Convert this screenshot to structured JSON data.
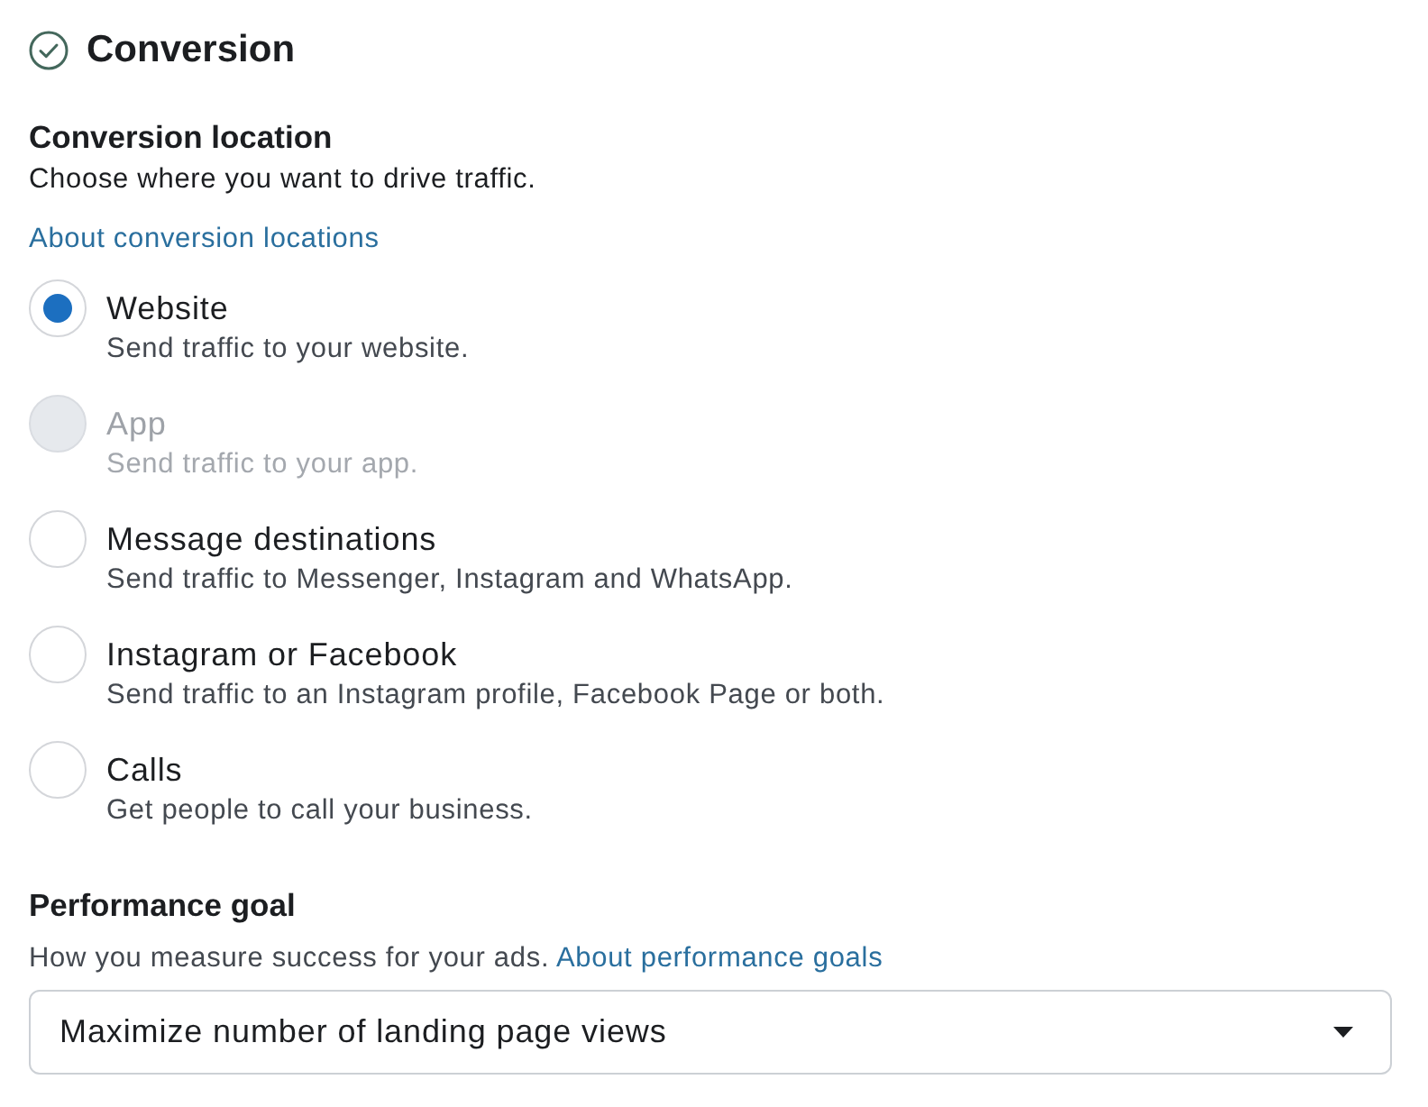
{
  "section": {
    "title": "Conversion"
  },
  "conversion_location": {
    "heading": "Conversion location",
    "description": "Choose where you want to drive traffic.",
    "link": "About conversion locations",
    "options": [
      {
        "label": "Website",
        "description": "Send traffic to your website.",
        "selected": true,
        "disabled": false
      },
      {
        "label": "App",
        "description": "Send traffic to your app.",
        "selected": false,
        "disabled": true
      },
      {
        "label": "Message destinations",
        "description": "Send traffic to Messenger, Instagram and WhatsApp.",
        "selected": false,
        "disabled": false
      },
      {
        "label": "Instagram or Facebook",
        "description": "Send traffic to an Instagram profile, Facebook Page or both.",
        "selected": false,
        "disabled": false
      },
      {
        "label": "Calls",
        "description": "Get people to call your business.",
        "selected": false,
        "disabled": false
      }
    ]
  },
  "performance_goal": {
    "heading": "Performance goal",
    "description": "How you measure success for your ads.",
    "link": "About performance goals",
    "dropdown": {
      "value": "Maximize number of landing page views"
    }
  }
}
